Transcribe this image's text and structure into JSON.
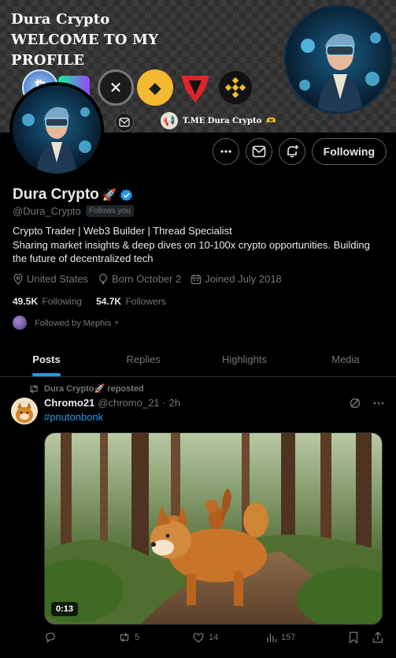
{
  "banner": {
    "title_lines": [
      "Dura Crypto",
      "WELCOME TO MY",
      "PROFILE"
    ],
    "telegram_text": "T.ME Dura Crypto"
  },
  "profile": {
    "name": "Dura Crypto",
    "name_emoji": "🚀",
    "handle": "@Dura_Crypto",
    "follows_you": "Follows you",
    "bio_line1": "Crypto Trader | Web3 Builder | Thread Specialist",
    "bio_line2": "Sharing market insights & deep dives on 10-100x crypto opportunities. Building the future of decentralized tech",
    "location": "United States",
    "born": "Born October 2",
    "joined": "Joined July 2018",
    "following_count": "49.5K",
    "following_label": "Following",
    "followers_count": "54.7K",
    "followers_label": "Followers",
    "followed_by": "Followed by Mephis",
    "followed_by_emoji": "⚡"
  },
  "actions": {
    "following_button": "Following"
  },
  "tabs": [
    {
      "label": "Posts",
      "active": true
    },
    {
      "label": "Replies",
      "active": false
    },
    {
      "label": "Highlights",
      "active": false
    },
    {
      "label": "Media",
      "active": false
    }
  ],
  "post": {
    "repost_by": "Dura Crypto🚀 reposted",
    "author_name": "Chromo21",
    "author_handle": "@chromo_21",
    "time": "· 2h",
    "text": "#pnutonbonk",
    "video_duration": "0:13",
    "reposts": "5",
    "likes": "14",
    "views": "157"
  },
  "colors": {
    "accent": "#1d9bf0",
    "muted": "#71767b",
    "text": "#e7e9ea",
    "border": "#2f3336"
  }
}
